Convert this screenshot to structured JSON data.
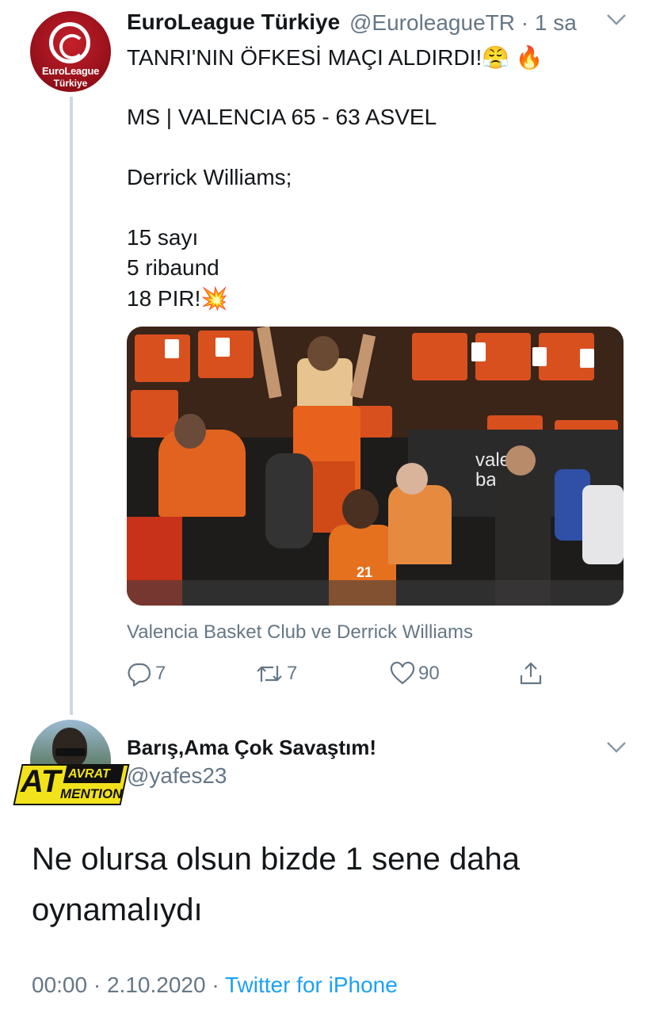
{
  "tweet": {
    "author_name": "EuroLeague Türkiye",
    "author_handle": "@EuroleagueTR",
    "time": "· 1 sa",
    "avatar_text_1": "EuroLeague",
    "avatar_text_2": "Türkiye",
    "lines": [
      "TANRI'NIN ÖFKESİ MAÇI ALDIRDI!😤 🔥",
      "MS | VALENCIA 65 - 63 ASVEL",
      "Derrick Williams;",
      "15 sayı",
      "5 ribaund",
      "18 PIR!💥"
    ],
    "media_caption": "Valencia Basket Club ve Derrick Williams",
    "media_texts": {
      "sponsor1": "valer",
      "sponsor2": "bask",
      "jersey_number": "21"
    },
    "reply_count": "7",
    "retweet_count": "7",
    "like_count": "90"
  },
  "reply": {
    "author_name": "Barış,Ama Çok Savaştım!",
    "author_handle": "@yafes23",
    "badge_big": "AT",
    "badge_top": "AVRAT",
    "badge_bottom": "MENTION",
    "text_line1": "Ne olursa olsun bizde 1 sene daha",
    "text_line2": "oynamalıydı",
    "time": "00:00",
    "date": "2.10.2020",
    "source": "Twitter for iPhone"
  },
  "icons": [
    "reply-icon",
    "retweet-icon",
    "like-icon",
    "share-icon",
    "chevron-down-icon"
  ],
  "colors": {
    "accent": "#1da1f2",
    "secondary_text": "#657786",
    "brand_red": "#c5202b"
  }
}
